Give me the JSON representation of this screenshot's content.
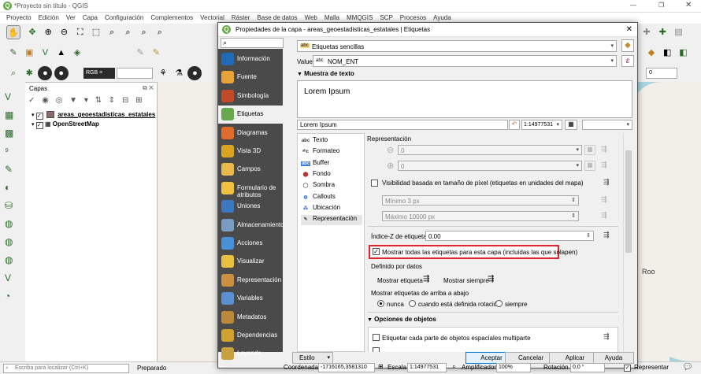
{
  "app": {
    "title": "*Proyecto sin título - QGIS",
    "logo": "Q"
  },
  "menu": [
    "Proyecto",
    "Edición",
    "Ver",
    "Capa",
    "Configuración",
    "Complementos",
    "Vectorial",
    "Ráster",
    "Base de datos",
    "Web",
    "Malla",
    "MMQGIS",
    "SCP",
    "Procesos",
    "Ayuda"
  ],
  "toolbar": {
    "rgb_label": "RGB =",
    "right_value": "0"
  },
  "layers_panel": {
    "title": "Capas",
    "items": [
      {
        "name": "areas_geoestadisticas_estatales",
        "color": "#8b6a6a"
      },
      {
        "name": "OpenStreetMap"
      }
    ]
  },
  "map": {
    "label": "Roo",
    "bg": "#a9d3df",
    "land": "#f2efe9"
  },
  "status": {
    "search_placeholder": "Escriba para localizar (Ctrl+K)",
    "state": "Preparado",
    "coord_label": "Coordenada",
    "coord_value": "-1716165,3581310",
    "scale_label": "Escala",
    "scale_value": "1:14977531",
    "magnifier_label": "Amplificador",
    "magnifier_value": "100%",
    "rotation_label": "Rotación",
    "rotation_value": "0,0 °",
    "render_label": "Representar"
  },
  "dialog": {
    "title": "Propiedades de la capa - areas_geoestadisticas_estatales | Etiquetas",
    "sidebar": [
      {
        "label": "Información",
        "color": "#1f6bb5"
      },
      {
        "label": "Fuente",
        "color": "#e8a23a"
      },
      {
        "label": "Simbología",
        "color": "#c04a2a"
      },
      {
        "label": "Etiquetas",
        "color": "#6aa84f"
      },
      {
        "label": "Diagramas",
        "color": "#e06c2c"
      },
      {
        "label": "Vista 3D",
        "color": "#d9a520"
      },
      {
        "label": "Campos",
        "color": "#e8b84a"
      },
      {
        "label": "Formulario de atributos",
        "color": "#f0c040"
      },
      {
        "label": "Uniones",
        "color": "#3b78c0"
      },
      {
        "label": "Almacenamiento",
        "color": "#7a9cc0"
      },
      {
        "label": "Acciones",
        "color": "#4a90d9"
      },
      {
        "label": "Visualizar",
        "color": "#e8c040"
      },
      {
        "label": "Representación",
        "color": "#c89040"
      },
      {
        "label": "Variables",
        "color": "#5b8fcf"
      },
      {
        "label": "Metadatos",
        "color": "#ba8a3a"
      },
      {
        "label": "Dependencias",
        "color": "#d0a030"
      },
      {
        "label": "Leyenda",
        "color": "#c8a040"
      }
    ],
    "search_placeholder": "",
    "mode": {
      "icon": "abc",
      "value": "Etiquetas sencillas"
    },
    "value_label": "Value",
    "value_field": "NOM_ENT",
    "preview_section": "Muestra de texto",
    "preview_text": "Lorem Ipsum",
    "preview_input": "Lorem Ipsum",
    "preview_scale": "1:14977531",
    "tabs": [
      "Texto",
      "Formateo",
      "Buffer",
      "Fondo",
      "Sombra",
      "Callouts",
      "Ubicación",
      "Representación"
    ],
    "rendering": {
      "heading": "Representación",
      "scale_min": "0",
      "scale_max": "0",
      "pixel_vis_label": "Visibilidad basada en tamaño de píxel (etiquetas en unidades del mapa)",
      "min_px": "Mínimo 3 px",
      "max_px": "Máximo 10000 px",
      "zindex_label": "Índice-Z de etiquetas",
      "zindex_value": "0.00",
      "show_all_label": "Mostrar todas las etiquetas para esta capa (incluidas las que solapen)",
      "data_defined": "Definido por datos",
      "show_label": "Mostrar etiqueta",
      "always_show": "Mostrar siempre",
      "upside_label": "Mostrar etiquetas de arriba a abajo",
      "radio_never": "nunca",
      "radio_rotation": "cuando está definida rotación",
      "radio_always": "siempre",
      "features_section": "Opciones de objetos",
      "multipart_label": "Etiquetar cada parte de objetos espaciales multiparte"
    },
    "buttons": {
      "style": "Estilo",
      "accept": "Aceptar",
      "cancel": "Cancelar",
      "apply": "Aplicar",
      "help": "Ayuda"
    },
    "highlight_color": "#e0262a"
  }
}
